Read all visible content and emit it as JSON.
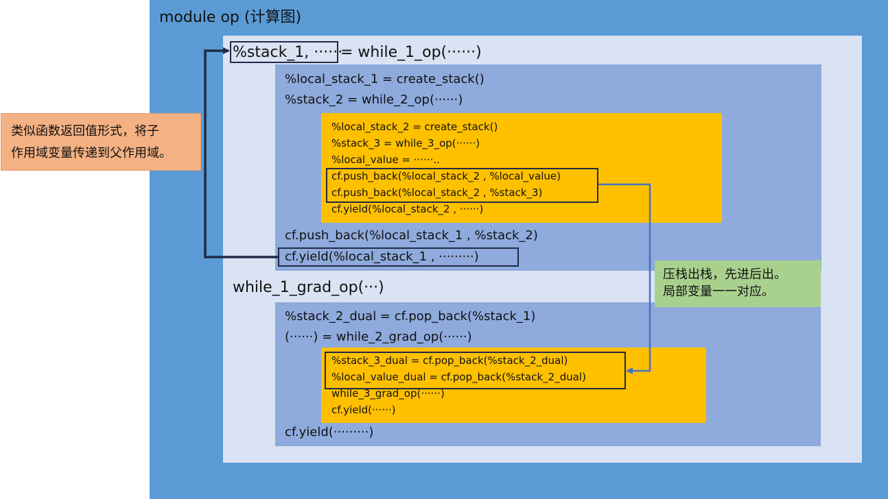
{
  "module_title": "module op (计算图)",
  "while1": {
    "header_left": "%stack_1, ······",
    "header_right": "= while_1_op(······)",
    "lines": [
      "%local_stack_1 = create_stack()",
      "%stack_2 = while_2_op(······)"
    ],
    "push_back": "cf.push_back(%local_stack_1 , %stack_2)",
    "yield": "cf.yield(%local_stack_1 ,   ·········)"
  },
  "while2_block": {
    "lines": [
      "%local_stack_2 = create_stack()",
      "%stack_3 = while_3_op(······)",
      "%local_value = ······.."
    ],
    "push_lines": [
      "cf.push_back(%local_stack_2 , %local_value)",
      "cf.push_back(%local_stack_2 , %stack_3)"
    ],
    "yield": "cf.yield(%local_stack_2 , ······)"
  },
  "grad": {
    "title": "while_1_grad_op(···)",
    "lines": [
      "%stack_2_dual = cf.pop_back(%stack_1)",
      "(······) = while_2_grad_op(······)"
    ],
    "pop_lines": [
      "%stack_3_dual = cf.pop_back(%stack_2_dual)",
      "%local_value_dual = cf.pop_back(%stack_2_dual)"
    ],
    "inner_lines": [
      "while_3_grad_op(······)",
      "cf.yield(······)"
    ],
    "yield": "cf.yield(·········)"
  },
  "callouts": {
    "orange": [
      "类似函数返回值形式，将子",
      "作用域变量传递到父作用域。"
    ],
    "green": [
      "压栈出栈，先进后出。",
      "局部变量一一对应。"
    ]
  },
  "colors": {
    "outer": "#5b9bd5",
    "inner": "#dae3f3",
    "block": "#8faadc",
    "gold": "#ffc000",
    "orange": "#f4b183",
    "green": "#a9d18e",
    "arrow_dark": "#1f2a44",
    "arrow_blue": "#4472c4"
  }
}
